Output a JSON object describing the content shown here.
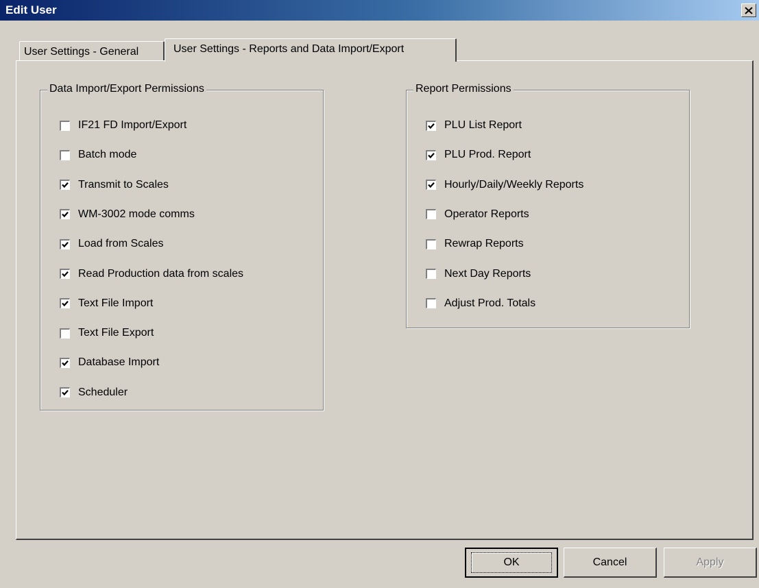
{
  "window": {
    "title": "Edit User",
    "close_icon": "close-icon"
  },
  "tabs": [
    {
      "label": "User Settings - General",
      "active": false
    },
    {
      "label": "User Settings - Reports and Data Import/Export",
      "active": true
    }
  ],
  "data_group": {
    "legend": "Data Import/Export Permissions",
    "items": [
      {
        "label": "IF21 FD Import/Export",
        "checked": false
      },
      {
        "label": "Batch mode",
        "checked": false
      },
      {
        "label": "Transmit to Scales",
        "checked": true
      },
      {
        "label": "WM-3002 mode comms",
        "checked": true
      },
      {
        "label": "Load from Scales",
        "checked": true
      },
      {
        "label": "Read Production data from scales",
        "checked": true
      },
      {
        "label": "Text File Import",
        "checked": true
      },
      {
        "label": "Text File Export",
        "checked": false
      },
      {
        "label": "Database Import",
        "checked": true
      },
      {
        "label": "Scheduler",
        "checked": true
      }
    ]
  },
  "report_group": {
    "legend": "Report Permissions",
    "items": [
      {
        "label": "PLU List Report",
        "checked": true
      },
      {
        "label": "PLU Prod. Report",
        "checked": true
      },
      {
        "label": "Hourly/Daily/Weekly Reports",
        "checked": true
      },
      {
        "label": "Operator Reports",
        "checked": false
      },
      {
        "label": "Rewrap Reports",
        "checked": false
      },
      {
        "label": "Next Day Reports",
        "checked": false
      },
      {
        "label": "Adjust Prod. Totals",
        "checked": false
      }
    ]
  },
  "buttons": {
    "ok": "OK",
    "cancel": "Cancel",
    "apply": "Apply",
    "apply_enabled": false
  },
  "colors": {
    "face": "#d4d0c8",
    "title_start": "#0a246a",
    "title_end": "#a6caf0",
    "disabled_text": "#808080"
  }
}
